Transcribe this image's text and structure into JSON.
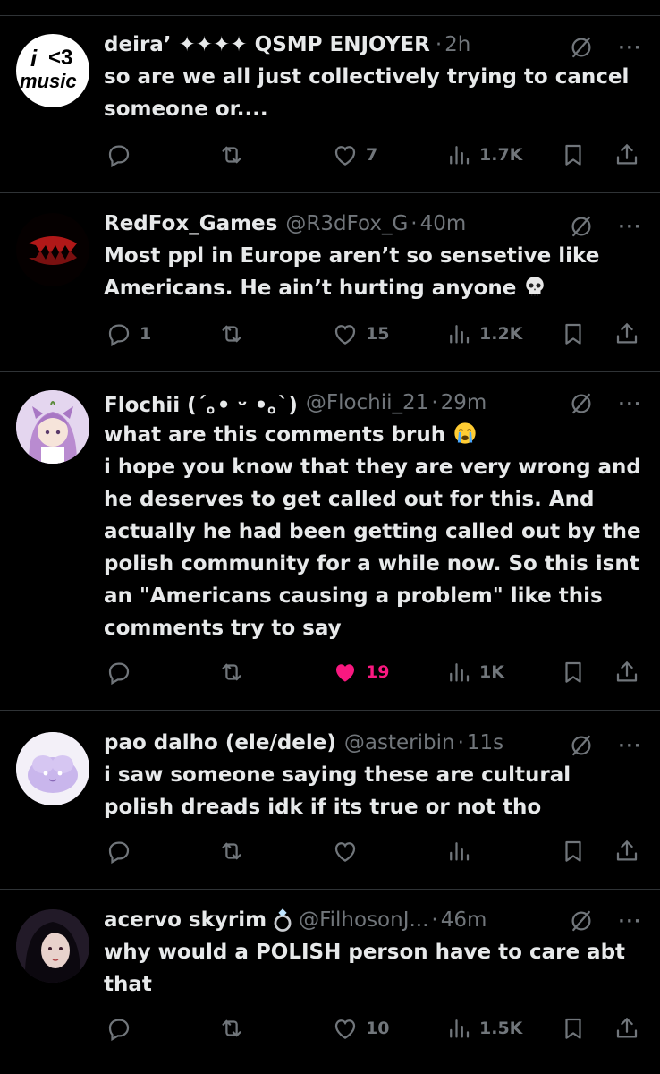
{
  "tweets": [
    {
      "name": "deira’ ✦✦✦✦ QSMP ENJOYER",
      "handle": "",
      "time": "2h",
      "text": "so are we all just collectively trying to cancel someone or....",
      "replies": "",
      "likes": "7",
      "views": "1.7K",
      "liked": false,
      "avatar": "i <3 music"
    },
    {
      "name": "RedFox_Games",
      "handle": "@R3dFox_G",
      "time": "40m",
      "text": "Most ppl in Europe aren’t so sensetive like Americans. He ain’t hurting anyone",
      "replies": "1",
      "likes": "15",
      "views": "1.2K",
      "liked": false
    },
    {
      "name": "Flochii (´｡• ᵕ •｡`)",
      "handle": "@Flochii_21",
      "time": "29m",
      "text_lines": [
        "what are this comments bruh",
        "i hope you know that they are very wrong and he deserves to get called out for this. And actually he had been getting called out by the polish community for a while now. So this isnt an \"Americans causing a problem\" like this comments try to say"
      ],
      "replies": "",
      "likes": "19",
      "views": "1K",
      "liked": true
    },
    {
      "name": "pao dalho (ele/dele)",
      "handle": "@asteribin",
      "time": "11s",
      "text": "i saw someone saying these are cultural polish dreads idk if its true or not tho",
      "replies": "",
      "likes": "",
      "views": "",
      "liked": false
    },
    {
      "name": "acervo skyrim",
      "handle": "@FilhosonJ...",
      "time": "46m",
      "text": "why would a POLISH person have to care abt that",
      "replies": "",
      "likes": "10",
      "views": "1.5K",
      "liked": false
    }
  ],
  "colors": {
    "background": "#000000",
    "text": "#e7e9ea",
    "muted": "#71767b",
    "like": "#f91880",
    "divider": "#2f3336"
  },
  "icons": [
    "reply-icon",
    "retweet-icon",
    "heart-icon",
    "views-icon",
    "bookmark-icon",
    "share-icon",
    "grok-icon",
    "more-icon"
  ]
}
